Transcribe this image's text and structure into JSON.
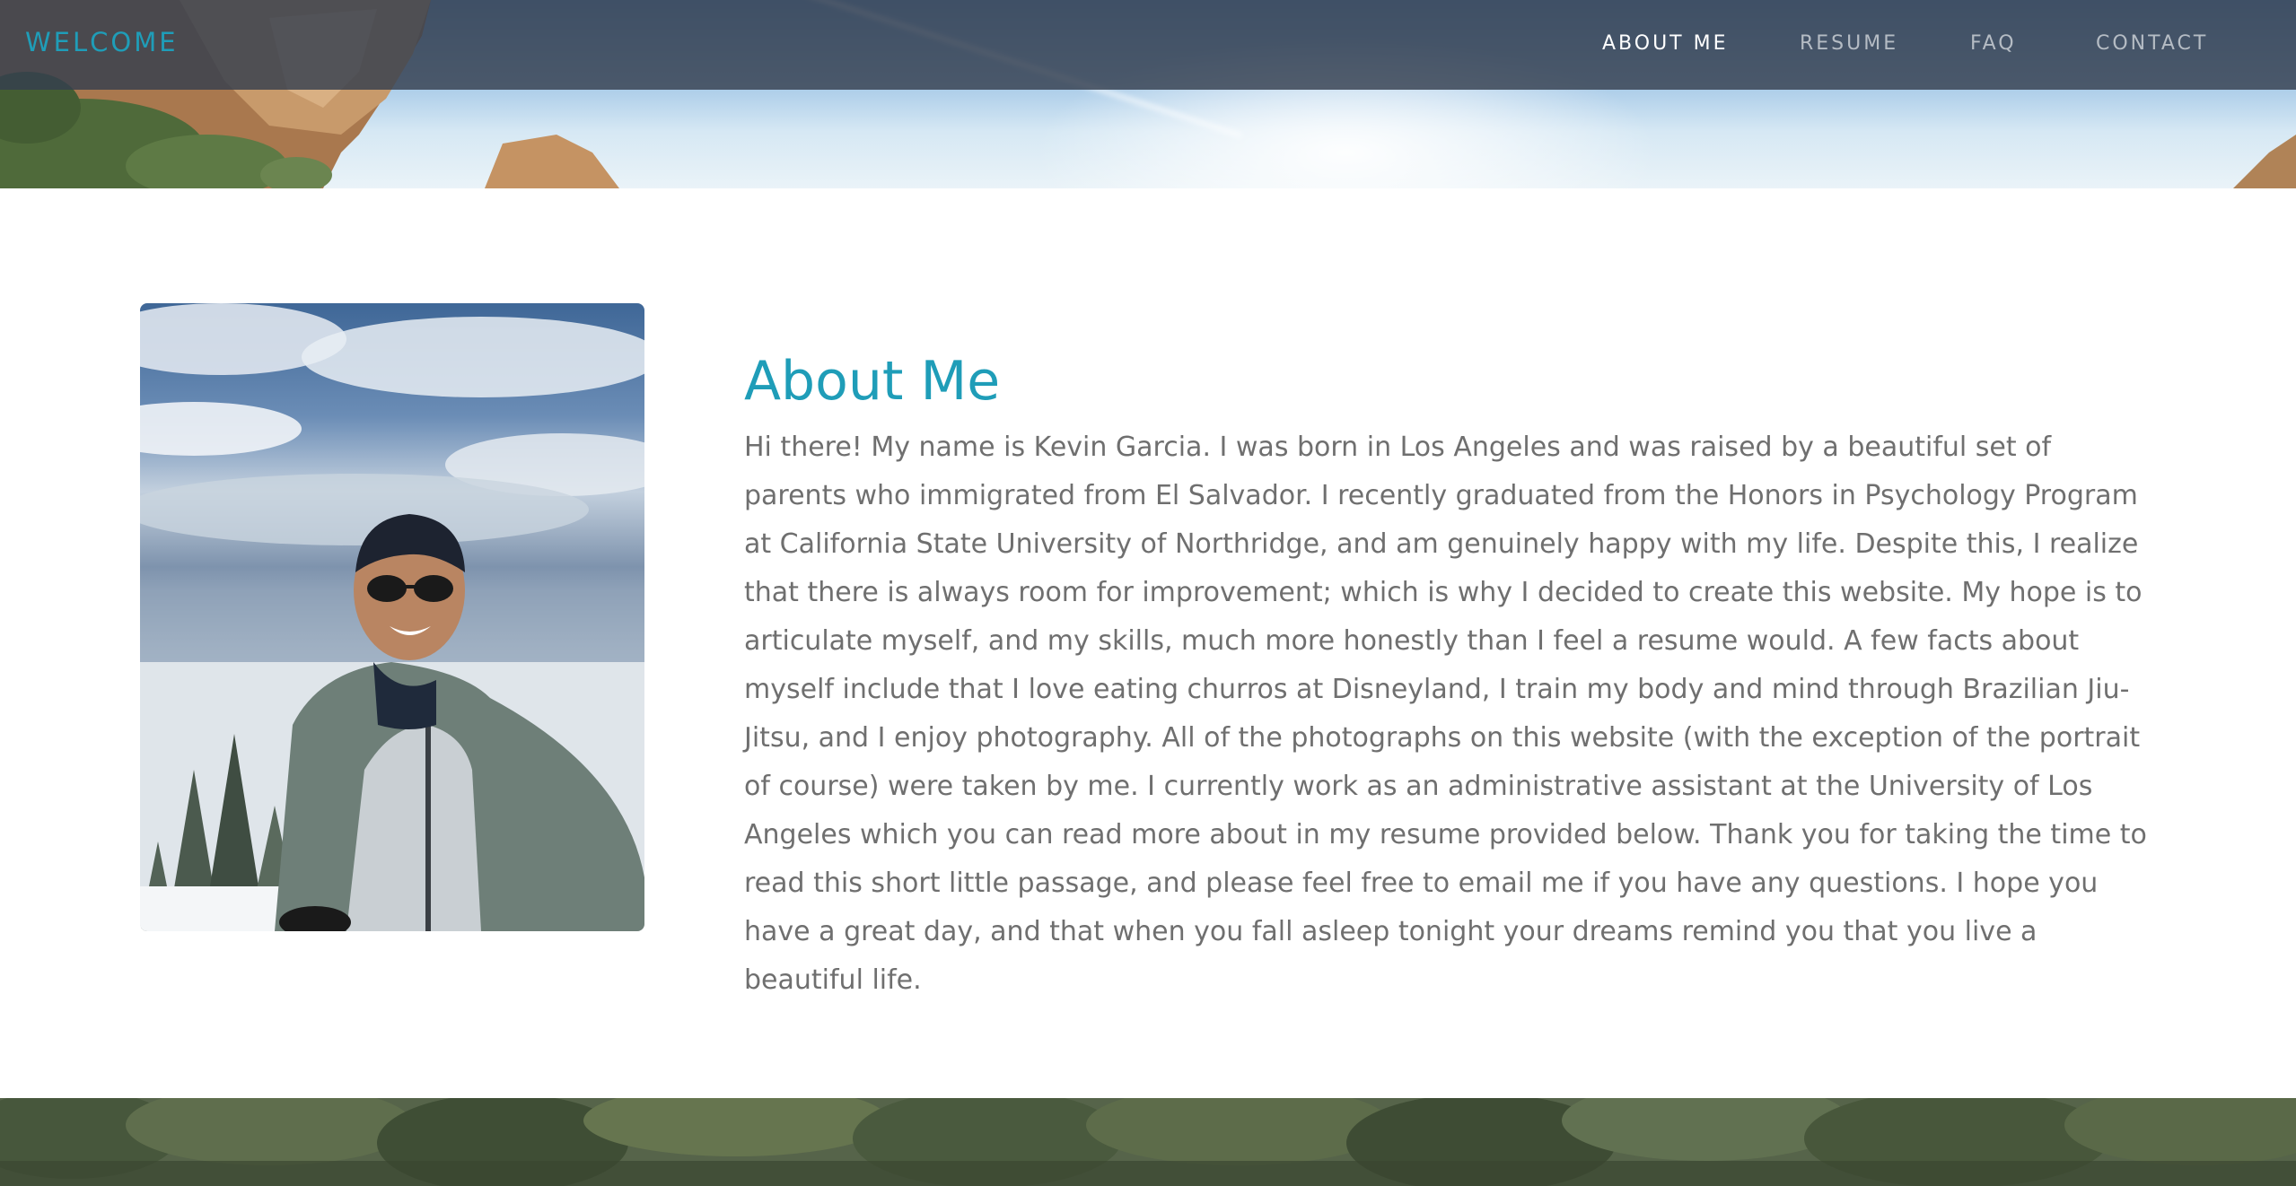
{
  "nav": {
    "brand": "WELCOME",
    "links": [
      {
        "label": "ABOUT ME",
        "active": true
      },
      {
        "label": "RESUME",
        "active": false
      },
      {
        "label": "FAQ",
        "active": false
      },
      {
        "label": "CONTACT",
        "active": false
      }
    ]
  },
  "about": {
    "title": "About Me",
    "body": "Hi there! My name is Kevin Garcia. I was born in Los Angeles and was raised by a beautiful set of parents who immigrated from El Salvador. I recently graduated from the Honors in Psychology Program at California State University of Northridge, and am genuinely happy with my life. Despite this, I realize that there is always room for improvement; which is why I decided to create this website. My hope is to articulate myself, and my skills, much more honestly than I feel a resume would. A few facts about myself include that I love eating churros at Disneyland, I train my body and mind through Brazilian Jiu-Jitsu, and I enjoy photography. All of the photographs on this website (with the exception of the portrait of course) were taken by me. I currently work as an administrative assistant at the University of Los Angeles which you can read more about in my resume provided below. Thank you for taking the time to read this short little passage, and please feel free to email me if you have any questions. I hope you have a great day, and that when you fall asleep tonight your dreams remind you that you live a beautiful life."
  },
  "colors": {
    "accent": "#1f9db8",
    "navbar": "#343e4e",
    "nav_inactive": "#b5bcc4",
    "nav_active": "#ffffff",
    "body_text": "#6f6f6f"
  }
}
